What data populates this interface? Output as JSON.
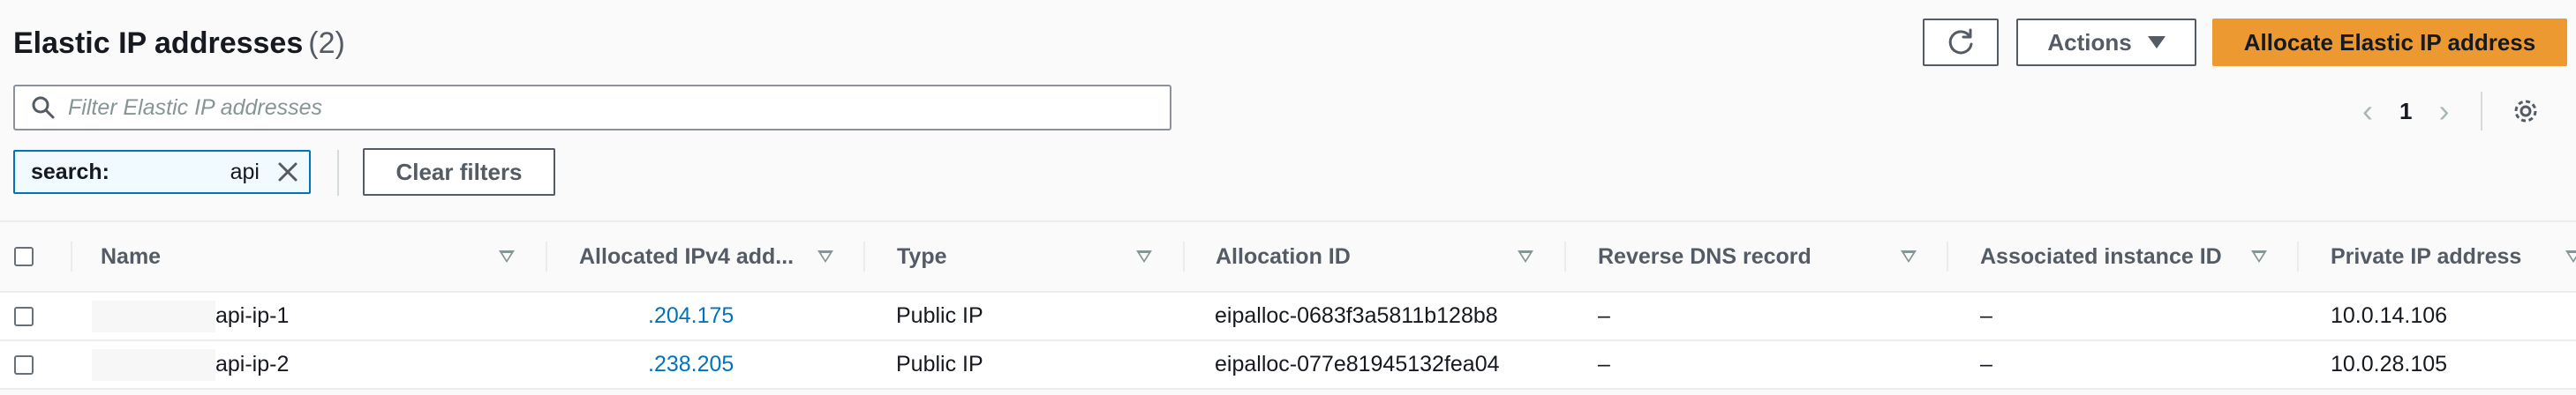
{
  "header": {
    "title": "Elastic IP addresses",
    "count": "(2)",
    "actions_label": "Actions",
    "allocate_label": "Allocate Elastic IP address"
  },
  "filter": {
    "placeholder": "Filter Elastic IP addresses",
    "value": ""
  },
  "pagination": {
    "current_page": "1"
  },
  "token": {
    "key": "search:",
    "value": "api"
  },
  "clear_filters_label": "Clear filters",
  "columns": [
    "Name",
    "Allocated IPv4 add...",
    "Type",
    "Allocation ID",
    "Reverse DNS record",
    "Associated instance ID",
    "Private IP address"
  ],
  "rows": [
    {
      "name": "api-ip-1",
      "ipv4": ".204.175",
      "type": "Public IP",
      "allocation_id": "eipalloc-0683f3a5811b128b8",
      "reverse_dns": "–",
      "instance_id": "–",
      "private_ip": "10.0.14.106"
    },
    {
      "name": "api-ip-2",
      "ipv4": ".238.205",
      "type": "Public IP",
      "allocation_id": "eipalloc-077e81945132fea04",
      "reverse_dns": "–",
      "instance_id": "–",
      "private_ip": "10.0.28.105"
    }
  ],
  "colors": {
    "primary": "#ec9932",
    "link": "#0073bb",
    "token_border": "#0073bb"
  },
  "icons": [
    "refresh-icon",
    "caret-down-icon",
    "search-icon",
    "chevron-left-icon",
    "chevron-right-icon",
    "gear-icon",
    "close-icon",
    "sort-icon"
  ]
}
